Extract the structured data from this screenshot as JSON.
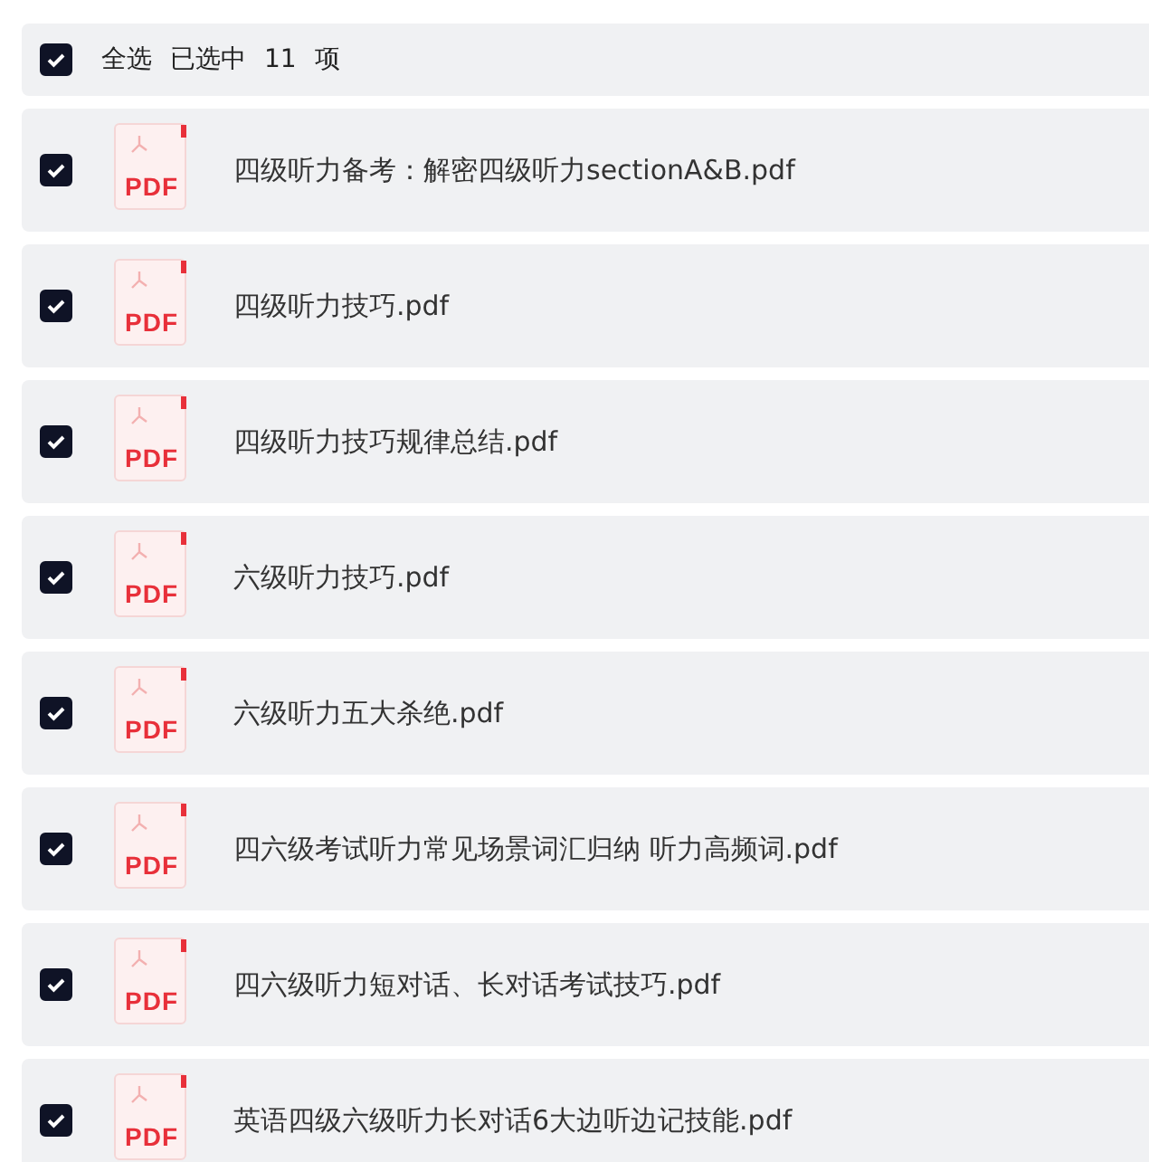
{
  "header": {
    "checked": true,
    "select_all": "全选",
    "selected_label": "已选中",
    "count": "11",
    "unit": "项"
  },
  "files": [
    {
      "name": "四级听力备考：解密四级听力sectionA&B.pdf",
      "badge": "PDF",
      "checked": true
    },
    {
      "name": "四级听力技巧.pdf",
      "badge": "PDF",
      "checked": true
    },
    {
      "name": "四级听力技巧规律总结.pdf",
      "badge": "PDF",
      "checked": true
    },
    {
      "name": "六级听力技巧.pdf",
      "badge": "PDF",
      "checked": true
    },
    {
      "name": "六级听力五大杀绝.pdf",
      "badge": "PDF",
      "checked": true
    },
    {
      "name": "四六级考试听力常见场景词汇归纳 听力高频词.pdf",
      "badge": "PDF",
      "checked": true
    },
    {
      "name": "四六级听力短对话、长对话考试技巧.pdf",
      "badge": "PDF",
      "checked": true
    },
    {
      "name": "英语四级六级听力长对话6大边听边记技能.pdf",
      "badge": "PDF",
      "checked": true
    }
  ]
}
